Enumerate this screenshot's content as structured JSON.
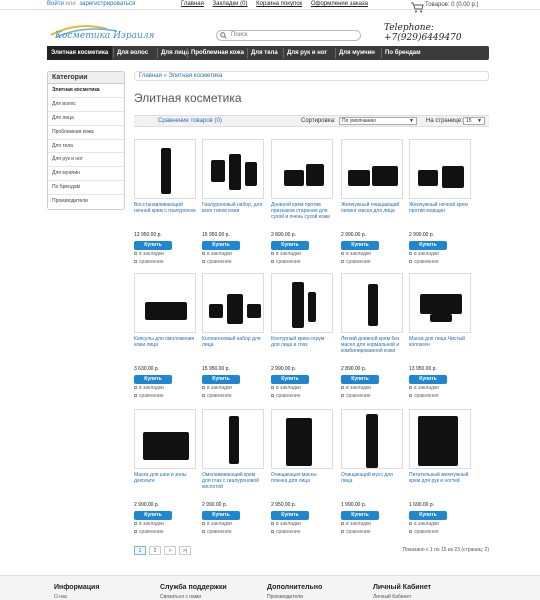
{
  "topbar": {
    "login": "Войти",
    "or": "или",
    "register": "зарегистрироваться",
    "links": [
      "Главная",
      "Закладки (0)",
      "Корзина покупок",
      "Оформление заказа"
    ],
    "cart": "Товаров: 0 (0.00 р.)"
  },
  "logo": {
    "text": "Косметика Израиля"
  },
  "search": {
    "placeholder": "Поиск"
  },
  "phone": {
    "label": "Telephone:",
    "number": "+7(929)6449470"
  },
  "nav": [
    "Элитная косметика",
    "Для волос",
    "Для лица",
    "Проблемная кожа",
    "Для тела",
    "Для рук и ног",
    "Для мужчин",
    "По брендам"
  ],
  "sidebar": {
    "title": "Категории",
    "items": [
      "Элитная косметика",
      "Для волос",
      "Для лица",
      "Проблемная кожа",
      "Для тела",
      "Для рук и ног",
      "Для мужчин",
      "По брендам",
      "Производители"
    ]
  },
  "breadcrumb": {
    "home": "Главная",
    "sep": "»",
    "current": "Элитная косметика"
  },
  "page_title": "Элитная косметика",
  "toolbar": {
    "compare": "Сравнение товаров (0)",
    "sort_label": "Сортировка:",
    "sort_value": "По умолчанию",
    "limit_label": "На странице:",
    "limit_value": "15"
  },
  "buy_label": "Купить",
  "wishlist_label": "в закладки",
  "compare_label": "сравнение",
  "products": [
    {
      "name": "Восстанавливающий ночной крем с гиалуроном",
      "price": "13 950.00 р."
    },
    {
      "name": "Гиалуроновый набор, для всех типов кожи",
      "price": "15 950.00 р."
    },
    {
      "name": "Дневной крем против признаков старения для сухой и очень сухой кожи",
      "price": "2 890.00 р."
    },
    {
      "name": "Жемчужный очищающий пилинг маска для лица",
      "price": "2 990.00 р."
    },
    {
      "name": "Жемчужный ночной крем против морщин",
      "price": "2 990.00 р."
    },
    {
      "name": "Капсулы для омоложения кожи лица",
      "price": "3 630.00 р."
    },
    {
      "name": "Коллагеновый набор для лица",
      "price": "15 950.00 р."
    },
    {
      "name": "Контурный крем-серум для лица и глаз",
      "price": "2 990.00 р."
    },
    {
      "name": "Легкий дневной крем без масел для нормальной и комбинированной кожи",
      "price": "2 890.00 р."
    },
    {
      "name": "Маска для лица Чистый коллаген",
      "price": "13 950.00 р."
    },
    {
      "name": "Маска для шеи и зоны декольте",
      "price": "2 990.00 р."
    },
    {
      "name": "Омолаживающий крем для глаз с гиалуроновой кислотой",
      "price": "2 990.00 р."
    },
    {
      "name": "Очищающая маска-пленка для лица",
      "price": "2 950.00 р."
    },
    {
      "name": "Очищающий мусс для лица",
      "price": "1 990.00 р."
    },
    {
      "name": "Питательный жемчужный крем для рук и ногтей",
      "price": "1 690.00 р."
    }
  ],
  "pager": {
    "pages": [
      "1",
      "2",
      ">",
      ">|"
    ],
    "info": "Показано с 1 по 15 из 23 (страниц: 2)"
  },
  "footer": [
    {
      "title": "Информация",
      "item": "О нас"
    },
    {
      "title": "Служба поддержки",
      "item": "Связаться с нами"
    },
    {
      "title": "Дополнительно",
      "item": "Производители"
    },
    {
      "title": "Личный Кабинет",
      "item": "Личный Кабинет"
    }
  ]
}
